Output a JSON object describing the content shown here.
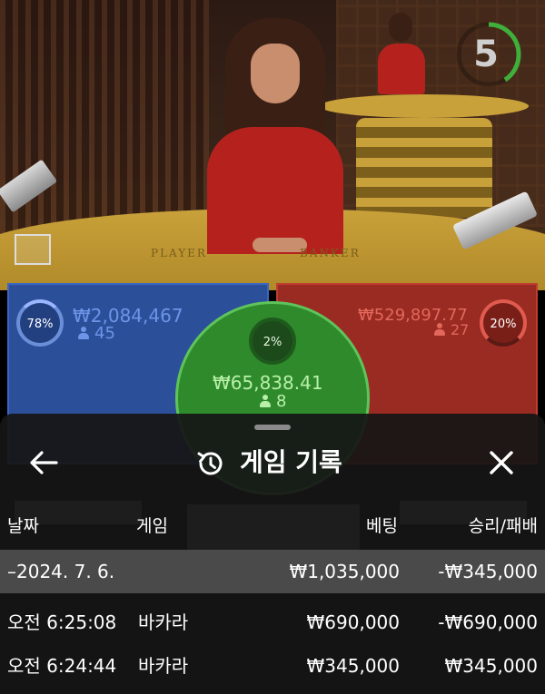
{
  "timer": {
    "value": "5"
  },
  "table_labels": {
    "player": "PLAYER",
    "banker": "BANKER"
  },
  "bets": {
    "player": {
      "percent": "78%",
      "amount": "₩2,084,467",
      "players": "45"
    },
    "tie": {
      "percent": "2%",
      "amount": "₩65,838.41",
      "players": "8"
    },
    "banker": {
      "percent": "20%",
      "amount": "₩529,897.77",
      "players": "27"
    }
  },
  "history": {
    "title": "게임 기록",
    "icons": {
      "back": "arrow-left-icon",
      "history": "history-clock-icon",
      "close": "close-icon"
    },
    "columns": {
      "date": "날짜",
      "game": "게임",
      "bet": "베팅",
      "result": "승리/패배"
    },
    "summary": {
      "date": "–2024. 7. 6.",
      "bet": "₩1,035,000",
      "result": "-₩345,000"
    },
    "rows": [
      {
        "time": "오전 6:25:08",
        "game": "바카라",
        "bet": "₩690,000",
        "result": "-₩690,000"
      },
      {
        "time": "오전 6:24:44",
        "game": "바카라",
        "bet": "₩345,000",
        "result": "₩345,000"
      }
    ]
  },
  "colors": {
    "player": "#2c4f9a",
    "banker": "#9a2b22",
    "tie": "#2f8a2c",
    "sheet": "#161616",
    "summary_row": "#4a4a4a"
  }
}
